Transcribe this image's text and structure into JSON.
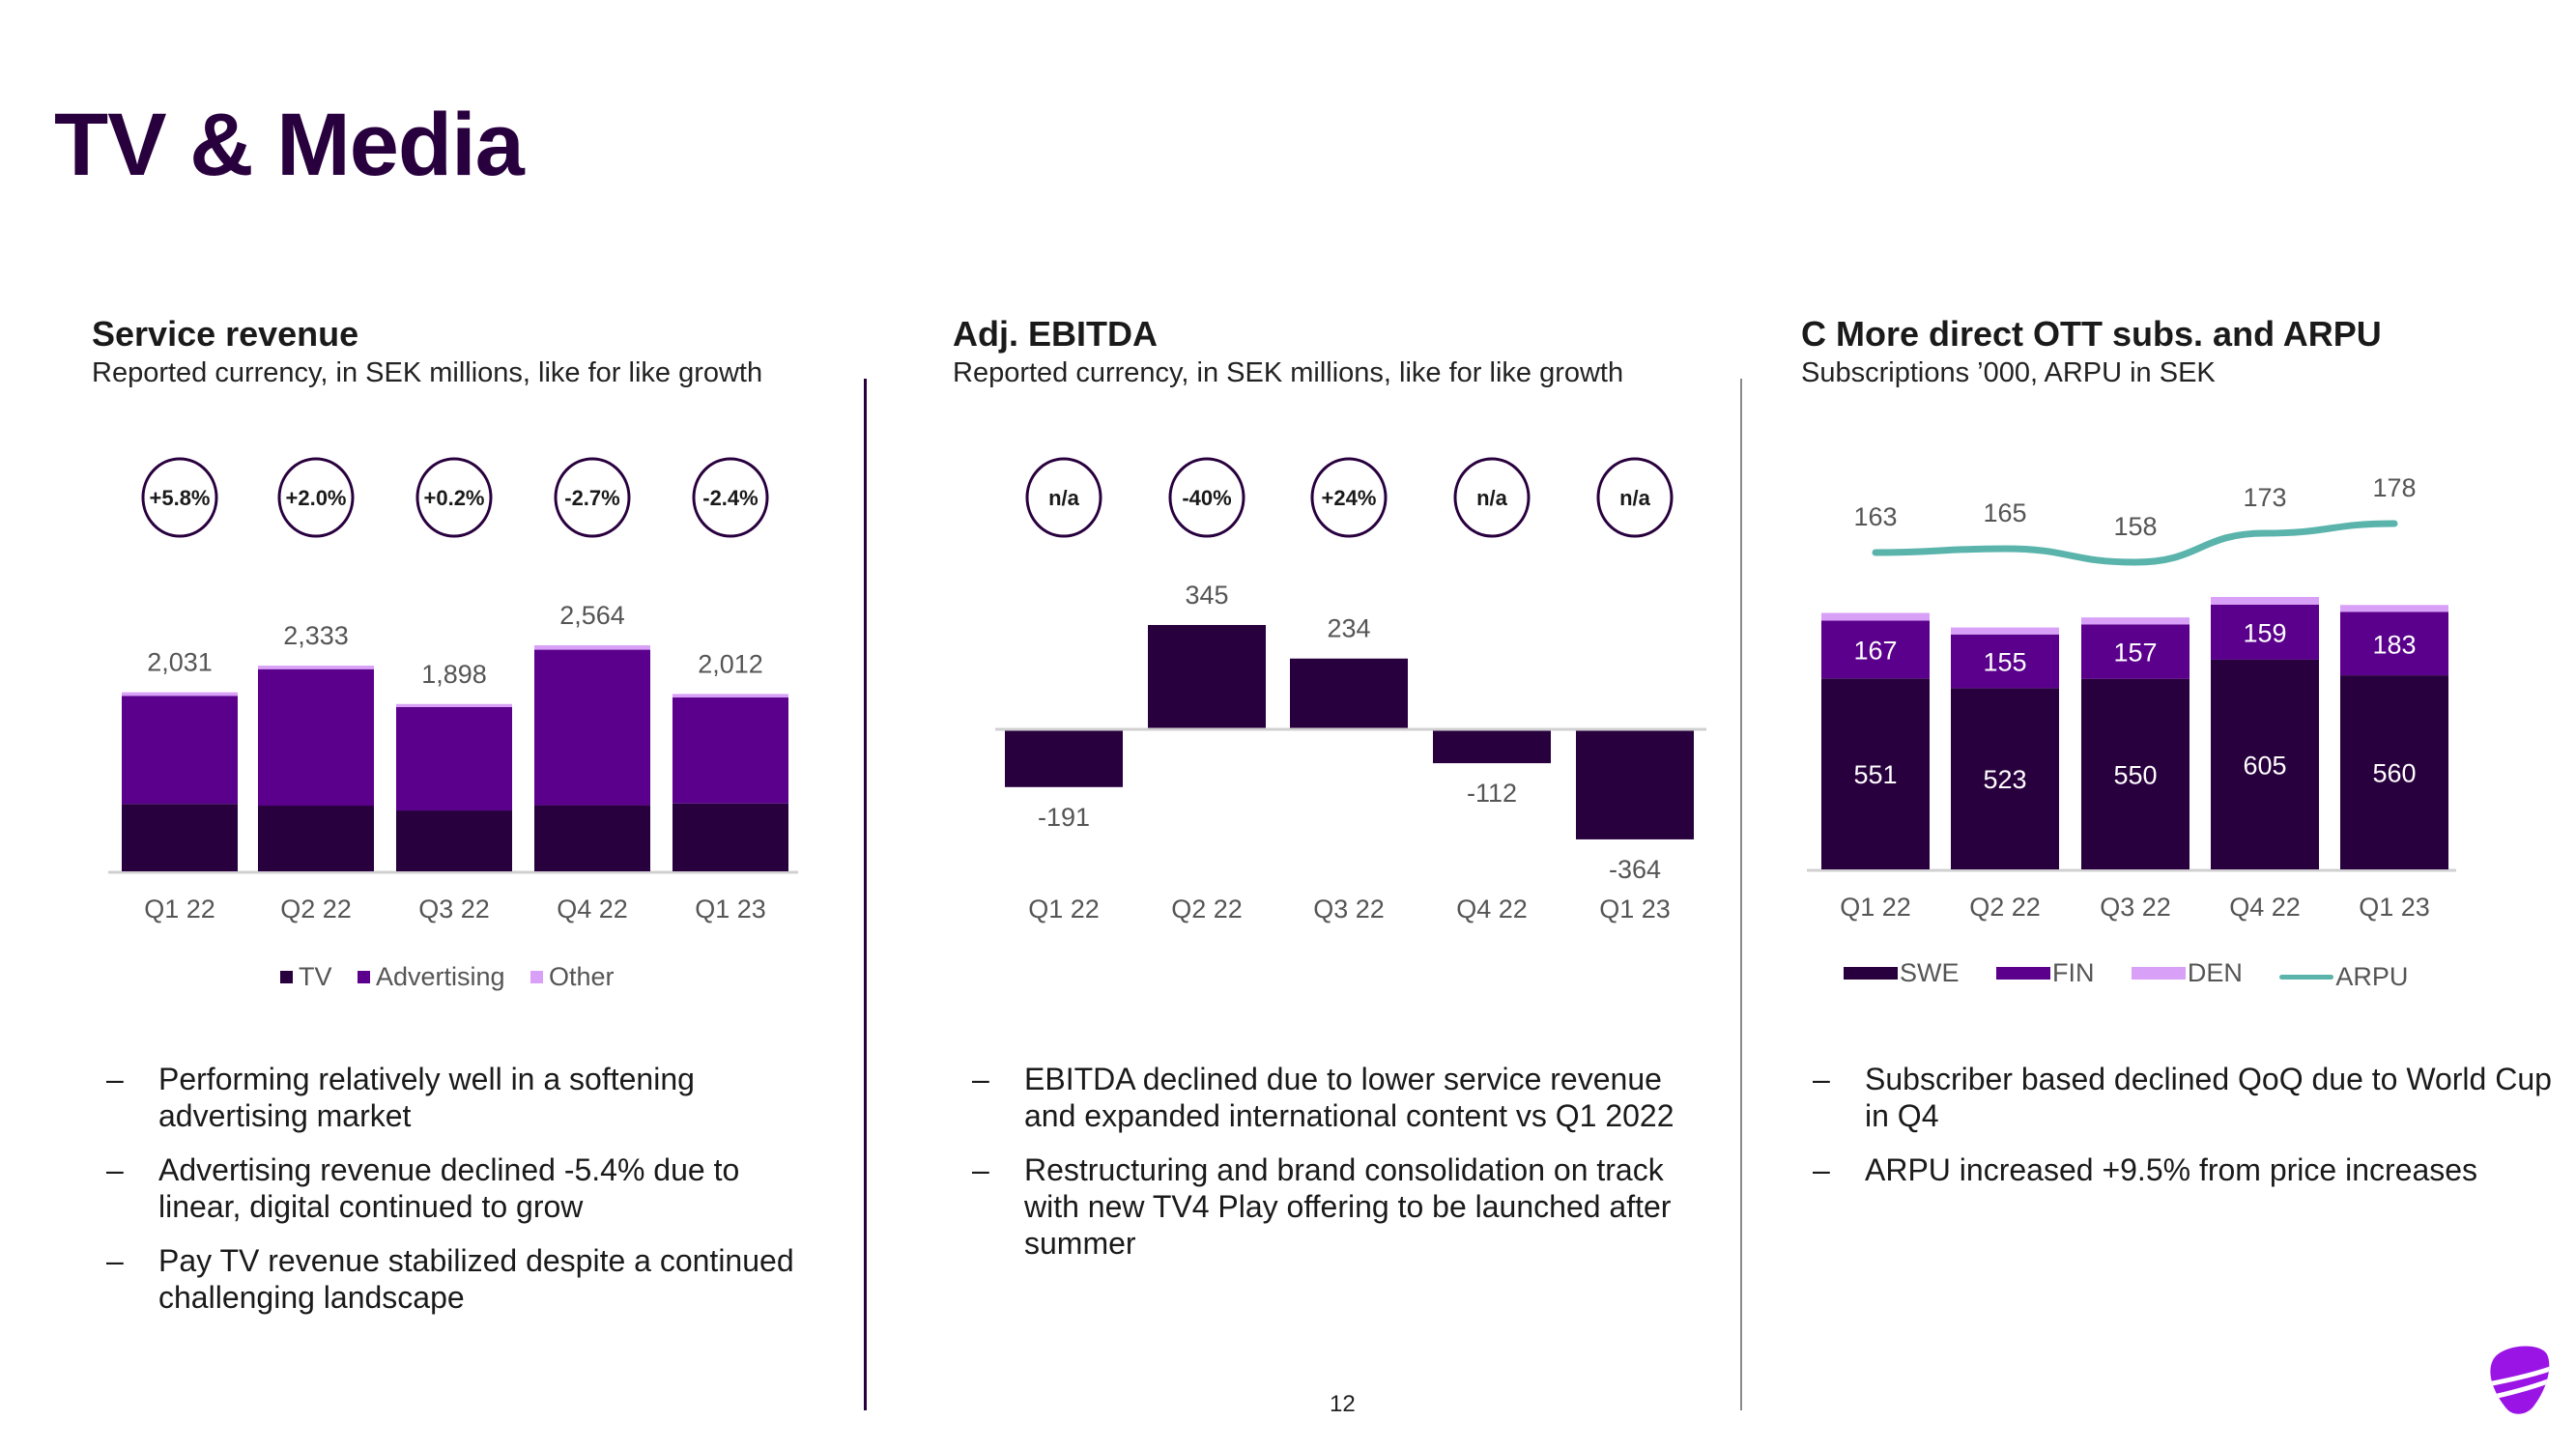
{
  "page": {
    "title": "TV & Media",
    "page_number": "12",
    "logo": "telia-logo-icon"
  },
  "colors": {
    "dark_purple": "#29003e",
    "purple": "#5a008c",
    "light_purple": "#d9a0f7",
    "teal": "#5ab4ac",
    "axis": "#d0d0d0",
    "label": "#555555",
    "logo": "#9b14e6"
  },
  "sections": [
    {
      "title": "Service revenue",
      "subtitle": "Reported currency, in SEK millions, like for like growth",
      "bullets": [
        "Performing relatively well in a softening advertising market",
        "Advertising revenue declined -5.4% due to linear, digital continued to grow",
        "Pay TV revenue stabilized despite a continued challenging landscape"
      ]
    },
    {
      "title": "Adj. EBITDA",
      "subtitle": "Reported currency, in SEK millions, like for like growth",
      "bullets": [
        "EBITDA declined due to lower service revenue and expanded international content vs Q1 2022",
        "Restructuring and brand consolidation on track with new TV4 Play offering to be launched after summer"
      ]
    },
    {
      "title": "C More direct OTT subs. and ARPU",
      "subtitle": "Subscriptions ’000, ARPU in SEK",
      "bullets": [
        "Subscriber based declined QoQ due to World Cup in Q4",
        "ARPU increased +9.5% from price increases"
      ]
    }
  ],
  "bullet_marker": "–",
  "chart_data": [
    {
      "type": "bar",
      "stacked": true,
      "title": "Service revenue",
      "categories": [
        "Q1 22",
        "Q2 22",
        "Q3 22",
        "Q4 22",
        "Q1 23"
      ],
      "totals": [
        2031,
        2333,
        1898,
        2564,
        2012
      ],
      "total_labels": [
        "2,031",
        "2,333",
        "1,898",
        "2,564",
        "2,012"
      ],
      "growth_badges": [
        "+5.8%",
        "+2.0%",
        "+0.2%",
        "-2.7%",
        "-2.4%"
      ],
      "series": [
        {
          "name": "TV",
          "color": "#29003e",
          "values": [
            765,
            745,
            690,
            750,
            770
          ]
        },
        {
          "name": "Advertising",
          "color": "#5a008c",
          "values": [
            1226,
            1548,
            1173,
            1764,
            1202
          ]
        },
        {
          "name": "Other",
          "color": "#d9a0f7",
          "values": [
            40,
            40,
            35,
            50,
            40
          ]
        }
      ],
      "legend": [
        "TV",
        "Advertising",
        "Other"
      ],
      "legend_position": "bottom",
      "ylim": [
        0,
        2600
      ],
      "grid": false
    },
    {
      "type": "bar",
      "title": "Adj. EBITDA",
      "categories": [
        "Q1 22",
        "Q2 22",
        "Q3 22",
        "Q4 22",
        "Q1 23"
      ],
      "values": [
        -191,
        345,
        234,
        -112,
        -364
      ],
      "value_labels": [
        "-191",
        "345",
        "234",
        "-112",
        "-364"
      ],
      "growth_badges": [
        "n/a",
        "-40%",
        "+24%",
        "n/a",
        "n/a"
      ],
      "color": "#29003e",
      "ylim": [
        -400,
        400
      ],
      "grid": false
    },
    {
      "type": "bar",
      "stacked": true,
      "title": "C More direct OTT subs. and ARPU",
      "categories": [
        "Q1 22",
        "Q2 22",
        "Q3 22",
        "Q4 22",
        "Q1 23"
      ],
      "series": [
        {
          "name": "SWE",
          "color": "#29003e",
          "values": [
            551,
            523,
            550,
            605,
            560
          ]
        },
        {
          "name": "FIN",
          "color": "#5a008c",
          "values": [
            167,
            155,
            157,
            159,
            183
          ]
        },
        {
          "name": "DEN",
          "color": "#d9a0f7",
          "values": [
            22,
            20,
            20,
            22,
            20
          ]
        }
      ],
      "line_series": {
        "name": "ARPU",
        "color": "#5ab4ac",
        "values": [
          163,
          165,
          158,
          173,
          178
        ]
      },
      "legend": [
        "SWE",
        "FIN",
        "DEN",
        "ARPU"
      ],
      "legend_position": "bottom",
      "grid": false
    }
  ]
}
